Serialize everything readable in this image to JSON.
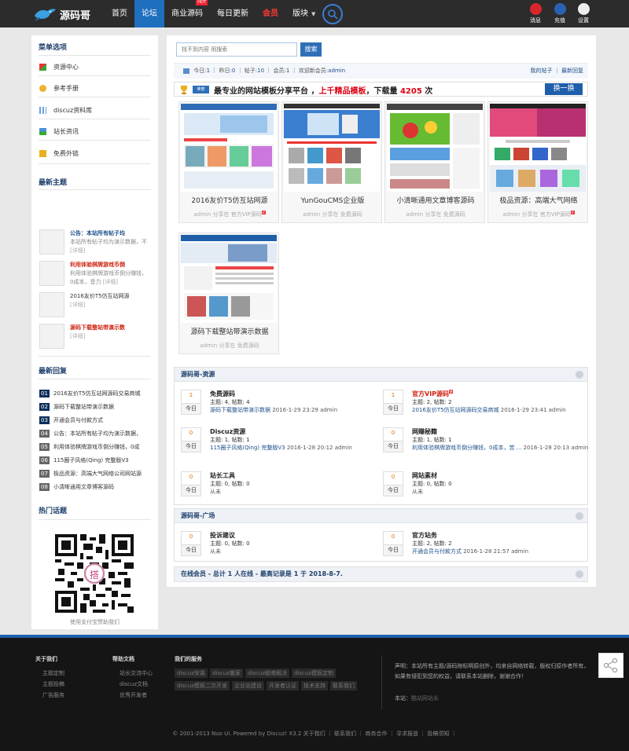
{
  "site": {
    "logo_text": "源码哥"
  },
  "nav": [
    {
      "label": "首页"
    },
    {
      "label": "论坛",
      "active": true
    },
    {
      "label": "商业源码",
      "badge": "HOT"
    },
    {
      "label": "每日更新"
    },
    {
      "label": "会员"
    },
    {
      "label": "版块"
    }
  ],
  "top_icons": [
    {
      "label": "消息",
      "icon": "bell-icon",
      "color": "#d9262c"
    },
    {
      "label": "充值",
      "icon": "coin-icon",
      "color": "#2a62b3"
    },
    {
      "label": "设置",
      "icon": "user-face-icon",
      "color": "#eeeeee"
    }
  ],
  "sidebar": {
    "menu_title": "菜单选项",
    "menu": [
      {
        "label": "资源中心"
      },
      {
        "label": "参考手册"
      },
      {
        "label": "discuz资料库"
      },
      {
        "label": "站长资讯"
      },
      {
        "label": "免费外链"
      }
    ],
    "new_topics_title": "最新主题",
    "new_topics": [
      {
        "title": "公告：本站所有帖子均",
        "desc": "本站所有帖子均为演示数据，不",
        "detail": "[详细]",
        "red": false
      },
      {
        "title": "利用体验棋牌游戏币倒",
        "desc": "利用体验棋牌游戏币倒分赚钱，0成本，音力",
        "detail": "[详细]",
        "red": true
      },
      {
        "title": "2016友价T5仿互站网源",
        "desc": "",
        "detail": "[详细]",
        "red": false
      },
      {
        "title": "源码下载整站带演示数",
        "desc": "",
        "detail": "[详细]",
        "red": true
      }
    ],
    "new_replies_title": "最新回复",
    "new_replies": [
      {
        "num": "01",
        "text": "2016友价T5仿互站网源码交易商城"
      },
      {
        "num": "02",
        "text": "源码下载整站带演示数据"
      },
      {
        "num": "03",
        "text": "开通会员与付款方式"
      },
      {
        "num": "04",
        "text": "公告：本站所有帖子均为演示数据，"
      },
      {
        "num": "05",
        "text": "利用体验棋牌游戏币倒分赚钱，0成"
      },
      {
        "num": "06",
        "text": "115圈子风格(Qing) 完整版V3"
      },
      {
        "num": "07",
        "text": "极品资源：高端大气网络公司网站源"
      },
      {
        "num": "08",
        "text": "小清晰通用文章博客源码"
      }
    ],
    "hot_title": "热门话题",
    "qr_caption": "使用支付宝赞助我们"
  },
  "main": {
    "search": {
      "placeholder": "找不到内容 用搜索",
      "button": "搜索"
    },
    "stats": {
      "today_label": "今日:",
      "today": "1",
      "yesterday_label": "昨日:",
      "yesterday": "0",
      "posts_label": "帖子:",
      "posts": "10",
      "members_label": "会员:",
      "members": "1",
      "newest_label": "欢迎新会员:",
      "newest": "admin",
      "my_posts": "我的帖子",
      "latest_reply": "最新回复"
    },
    "banner": {
      "tag": "荣誉",
      "text_a": "最专业的网站模板分享平台 ，",
      "text_b": "上千精品模板",
      "text_c": "，下载量 ",
      "count": "4205",
      "text_d": " 次",
      "swap": "换一换"
    },
    "cards": [
      {
        "title": "2016友价T5仿互站网源",
        "author": "admin",
        "share": "分享在",
        "board": "官方VIP源码",
        "vip": true
      },
      {
        "title": "YunGouCMS企业版",
        "author": "admin",
        "share": "分享在",
        "board": "免费源码",
        "vip": false
      },
      {
        "title": "小清晰通用文章博客源码",
        "author": "admin",
        "share": "分享在",
        "board": "免费源码",
        "vip": false
      },
      {
        "title": "极品资源：高端大气网络",
        "author": "admin",
        "share": "分享在",
        "board": "官方VIP源码",
        "vip": true
      },
      {
        "title": "源码下载整站带演示数据",
        "author": "admin",
        "share": "分享在",
        "board": "免费源码",
        "vip": false
      }
    ],
    "group1": {
      "title": "源码哥-资源",
      "forums": [
        {
          "count": "1",
          "day": "今日",
          "name": "免费源码",
          "stats": "主题: 4, 帖数: 4",
          "last_title": "源码下载整站带演示数据",
          "last_time": " 2016-1-29 23:29 admin",
          "red": false
        },
        {
          "count": "1",
          "day": "今日",
          "name": "官方VIP源码",
          "stats": "主题: 2, 帖数: 2",
          "last_title": "2016友价T5仿互站网源码交易商城",
          "last_time": " 2016-1-29 23:41 admin",
          "red": true
        },
        {
          "count": "0",
          "day": "今日",
          "name": "Discuz资源",
          "stats": "主题: 1, 帖数: 1",
          "last_title": "115圈子风格(Qing) 完整版V3",
          "last_time": " 2016-1-28 20:12 admin",
          "red": false
        },
        {
          "count": "0",
          "day": "今日",
          "name": "网赚秘籍",
          "stats": "主题: 1, 帖数: 1",
          "last_title": "利用体验棋牌游戏币倒分赚钱，0成本，苦 ...",
          "last_time": " 2016-1-28 20:13 admin",
          "red": false
        },
        {
          "count": "0",
          "day": "今日",
          "name": "站长工具",
          "stats": "主题: 0, 帖数: 0",
          "last_title": "",
          "last_time": "从未",
          "red": false
        },
        {
          "count": "0",
          "day": "今日",
          "name": "网站素材",
          "stats": "主题: 0, 帖数: 0",
          "last_title": "",
          "last_time": "从未",
          "red": false
        }
      ]
    },
    "group2": {
      "title": "源码哥-广场",
      "forums": [
        {
          "count": "0",
          "day": "今日",
          "name": "投诉建议",
          "stats": "主题: 0, 帖数: 0",
          "last_title": "",
          "last_time": "从未",
          "red": false
        },
        {
          "count": "0",
          "day": "今日",
          "name": "官方站务",
          "stats": "主题: 2, 帖数: 2",
          "last_title": "开通会员与付款方式",
          "last_time": " 2016-1-28 21:57 admin",
          "red": false
        }
      ]
    },
    "online": "在线会员 - 总计 1 人在线 - 最高记录是 1 于 2018-8-7."
  },
  "footer": {
    "about": {
      "title": "关于我们",
      "items": [
        "主题定制",
        "主题投稿",
        "广告服务"
      ]
    },
    "help": {
      "title": "帮助文档",
      "items": [
        "站长交流中心",
        "discuz文档",
        "优秀开发者"
      ]
    },
    "services": {
      "title": "我们的服务",
      "tags": [
        "discuz安装",
        "discuz搬家",
        "discuz疑难解决",
        "discuz模板定制",
        "discuz模板二次开发",
        "企业站建设",
        "开发者认证",
        "技术支持",
        "联系我们"
      ]
    },
    "declaration": "声明：本站所有主题/源码除标明原创外，均来自网络转载，版权归原作者所有，如果有侵犯到您的权益，请联系本站删除，谢谢合作！",
    "site_label": "本站：",
    "site_value": "酷站网站长",
    "copyright": "© 2001-2013 Nuo Ui. Powered by Discuz! X3.2 关于我们 ｜ 联系我们 ｜ 商务合作 ｜ 寻求报道 ｜ 投稿须知 ｜"
  }
}
